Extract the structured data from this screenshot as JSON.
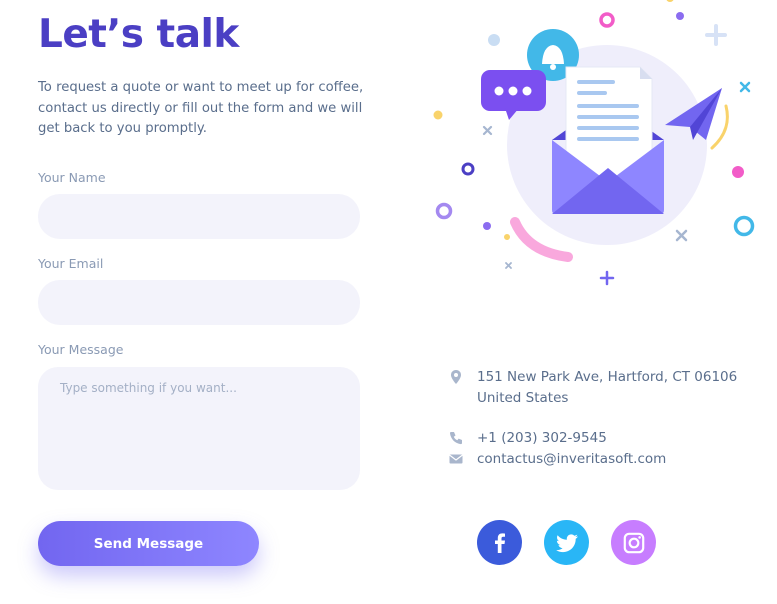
{
  "heading": "Let’s talk",
  "intro": "To request a quote or want to meet up for coffee, contact us directly or fill out the form and we will get back to you promptly.",
  "form": {
    "name_label": "Your Name",
    "name_value": "",
    "email_label": "Your Email",
    "email_value": "",
    "message_label": "Your Message",
    "message_placeholder": "Type something if you want...",
    "submit_label": "Send Message"
  },
  "contact": {
    "address_line1": "151 New Park Ave, Hartford, CT 06106",
    "address_line2": "United States",
    "phone": "+1 (203) 302-9545",
    "email": "contactus@inveritasoft.com"
  },
  "social": [
    {
      "name": "facebook",
      "icon": "facebook-icon",
      "color": "#3b5bdb"
    },
    {
      "name": "twitter",
      "icon": "twitter-icon",
      "color": "#29b6f6"
    },
    {
      "name": "instagram",
      "icon": "instagram-icon",
      "color": "#c77dff"
    }
  ],
  "colors": {
    "accent": "#4b3fc4",
    "button_gradient_start": "#7266f0",
    "button_gradient_end": "#8e86ff",
    "field_bg": "#f3f3fb",
    "body_text": "#5a6e8c",
    "label_text": "#8a9ab4"
  },
  "illustration": {
    "icons": [
      "envelope-icon",
      "document-icon",
      "paper-plane-icon",
      "chat-bubble-icon",
      "bell-icon"
    ]
  }
}
